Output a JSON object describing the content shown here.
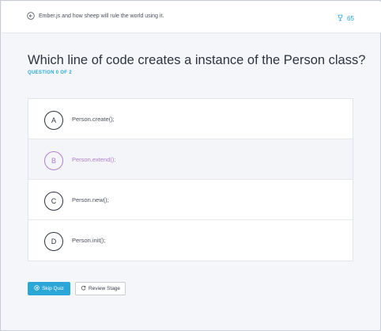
{
  "header": {
    "course_title": "Ember.js and how sheep will rule the world using it.",
    "points": "65",
    "back_icon": "arrow-left-circle-icon",
    "points_icon": "trophy-icon"
  },
  "question": {
    "title": "Which line of code creates a instance of the Person class?",
    "progress": "QUESTION 0 OF 2"
  },
  "options": [
    {
      "letter": "A",
      "text": "Person.create();",
      "hovered": false
    },
    {
      "letter": "B",
      "text": "Person.extend();",
      "hovered": true
    },
    {
      "letter": "C",
      "text": "Person.new();",
      "hovered": false
    },
    {
      "letter": "D",
      "text": "Person.init();",
      "hovered": false
    }
  ],
  "actions": {
    "skip_label": "Skip Quiz",
    "review_label": "Review Stage"
  },
  "colors": {
    "accent": "#2aa7d6",
    "hover_purple": "#b07fd0",
    "text_dark": "#2e3340"
  }
}
